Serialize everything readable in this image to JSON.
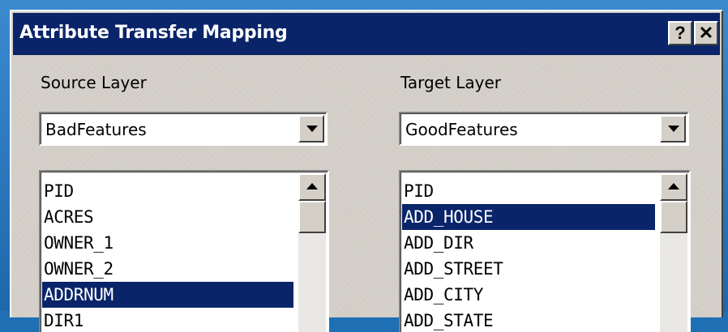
{
  "dialog": {
    "title": "Attribute Transfer Mapping",
    "help_label": "?",
    "close_label": "✕"
  },
  "source": {
    "label": "Source Layer",
    "selected_layer": "BadFeatures",
    "fields": [
      "PID",
      "ACRES",
      "OWNER_1",
      "OWNER_2",
      "ADDRNUM",
      "DIR1"
    ],
    "selected_field": "ADDRNUM"
  },
  "target": {
    "label": "Target Layer",
    "selected_layer": "GoodFeatures",
    "fields": [
      "PID",
      "ADD_HOUSE",
      "ADD_DIR",
      "ADD_STREET",
      "ADD_CITY",
      "ADD_STATE"
    ],
    "selected_field": "ADD_HOUSE"
  },
  "colors": {
    "titlebar": "#0a246a",
    "selection": "#0a246a",
    "face": "#d4d0c8",
    "desktop": "#1f6fb4"
  }
}
